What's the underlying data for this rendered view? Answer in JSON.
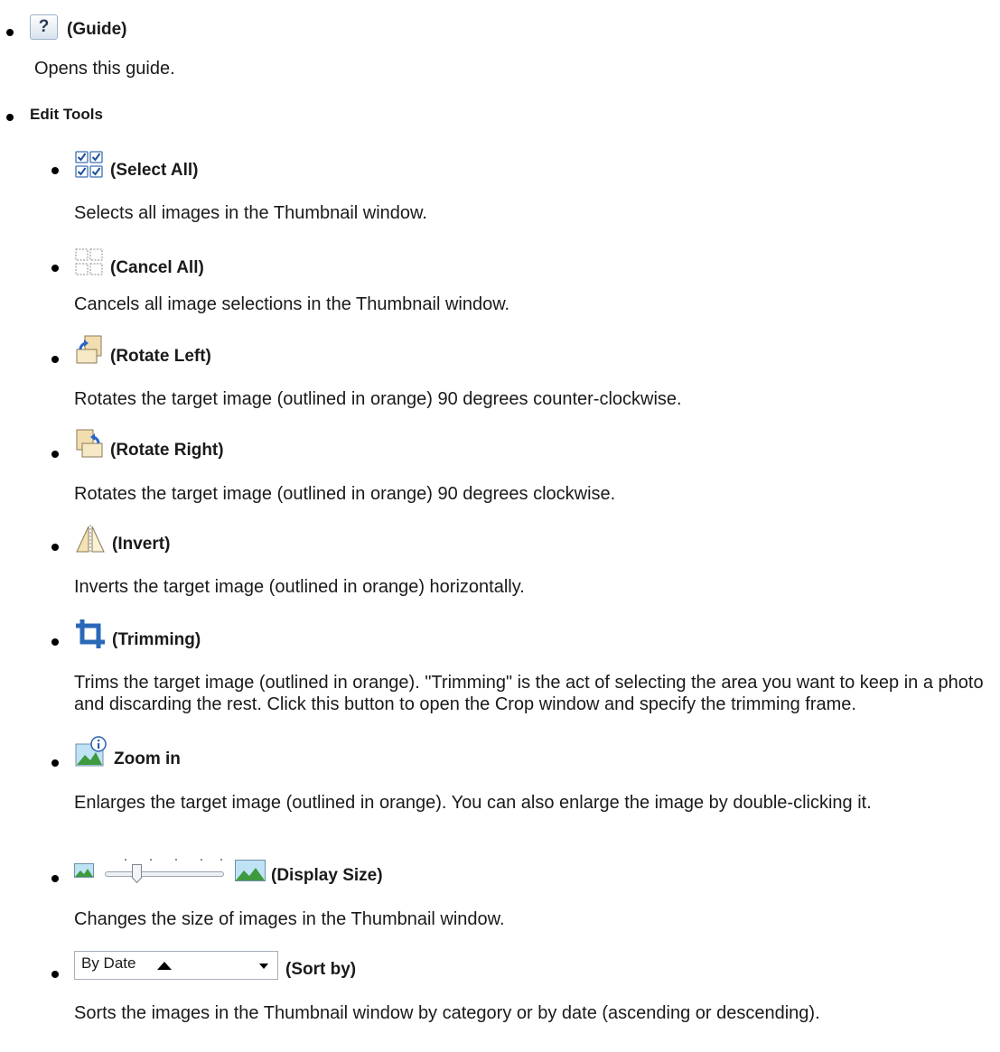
{
  "guide": {
    "icon": "help-icon",
    "glyph": "?",
    "label": "(Guide)",
    "desc": "Opens this guide."
  },
  "edit_tools": {
    "heading": "Edit Tools",
    "items": [
      {
        "icon": "select-all-icon",
        "label": "(Select All)",
        "desc": "Selects all images in the Thumbnail window."
      },
      {
        "icon": "cancel-all-icon",
        "label": "(Cancel All)",
        "desc": "Cancels all image selections in the Thumbnail window."
      },
      {
        "icon": "rotate-left-icon",
        "label": "(Rotate Left)",
        "desc": "Rotates the target image (outlined in orange) 90 degrees counter-clockwise."
      },
      {
        "icon": "rotate-right-icon",
        "label": "(Rotate Right)",
        "desc": "Rotates the target image (outlined in orange) 90 degrees clockwise."
      },
      {
        "icon": "invert-icon",
        "label": "(Invert)",
        "desc": "Inverts the target image (outlined in orange) horizontally."
      },
      {
        "icon": "trimming-icon",
        "label": "(Trimming)",
        "desc": "Trims the target image (outlined in orange). \"Trimming\" is the act of selecting the area you want to keep in a photo and discarding the rest. Click this button to open the Crop window and specify the trimming frame."
      },
      {
        "icon": "zoom-in-icon",
        "label": "Zoom in",
        "desc": "Enlarges the target image (outlined in orange). You can also enlarge the image by double-clicking it."
      },
      {
        "icon": "display-size-slider",
        "label": "(Display Size)",
        "desc": "Changes the size of images in the Thumbnail window.",
        "slider_level": 0.25
      },
      {
        "icon": "sort-dropdown",
        "label": "(Sort by)",
        "desc": "Sorts the images in the Thumbnail window by category or by date (ascending or descending).",
        "dropdown_value": "By Date"
      }
    ]
  }
}
